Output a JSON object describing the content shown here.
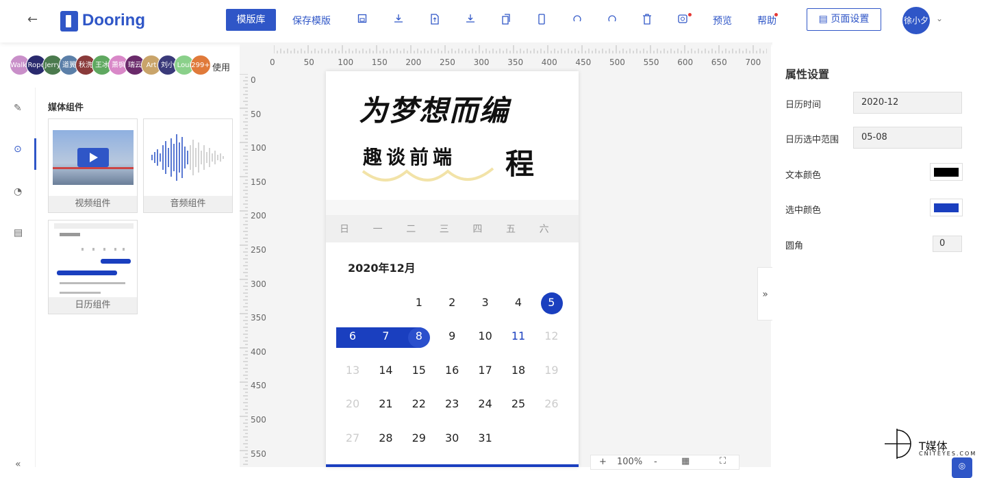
{
  "header": {
    "back_icon": "←",
    "logo": "Dooring",
    "template_btn": "模版库",
    "save_template": "保存模版",
    "preview": "预览",
    "help": "帮助",
    "page_settings": "页面设置",
    "user": "徐小夕",
    "accent": "#2f56c7",
    "toolbar_icons": [
      "save-icon",
      "download-icon",
      "file-upload-icon",
      "export-icon",
      "copy-icon",
      "mobile-icon",
      "undo-icon",
      "redo-icon",
      "trash-icon",
      "screenshot-icon"
    ]
  },
  "collaborators": {
    "names": [
      "Walker",
      "Ropo",
      "Jerry",
      "道翼",
      "秋洗",
      "王冰",
      "萧枫",
      "瑞云",
      "Art",
      "刘小刀",
      "Loui",
      "299+"
    ],
    "use_label": "使用"
  },
  "left_panel": {
    "section_title": "媒体组件",
    "components": [
      {
        "label": "视频组件"
      },
      {
        "label": "音频组件"
      },
      {
        "label": "日历组件"
      }
    ]
  },
  "canvas": {
    "ruler_top": [
      "0",
      "50",
      "100",
      "150",
      "200",
      "250",
      "300",
      "350",
      "400",
      "450",
      "500",
      "550",
      "600",
      "650",
      "700"
    ],
    "ruler_left": [
      "0",
      "50",
      "100",
      "150",
      "200",
      "250",
      "300",
      "350",
      "400",
      "450",
      "500",
      "550"
    ],
    "zoom": "100%",
    "zoom_plus": "+",
    "zoom_minus": "-"
  },
  "calendar": {
    "banner_line1": "为梦想而编",
    "banner_line2": "趣谈前端",
    "banner_line3": "程",
    "weekdays": [
      "日",
      "一",
      "二",
      "三",
      "四",
      "五",
      "六"
    ],
    "month_title": "2020年12月",
    "weeks": [
      [
        "",
        "",
        "1",
        "2",
        "3",
        "4",
        "5"
      ],
      [
        "6",
        "7",
        "8",
        "9",
        "10",
        "11",
        "12"
      ],
      [
        "13",
        "14",
        "15",
        "16",
        "17",
        "18",
        "19"
      ],
      [
        "20",
        "21",
        "22",
        "23",
        "24",
        "25",
        "26"
      ],
      [
        "27",
        "28",
        "29",
        "30",
        "31",
        "",
        ""
      ]
    ],
    "selected_color": "#1a3fbf"
  },
  "props": {
    "title": "属性设置",
    "calendar_time_label": "日历时间",
    "calendar_time": "2020-12",
    "range_label": "日历选中范围",
    "range": "05-08",
    "text_color_label": "文本颜色",
    "text_color": "#000000",
    "selected_color_label": "选中颜色",
    "selected_color": "#1a3fbf",
    "radius_label": "圆角",
    "radius": "0"
  },
  "watermark": {
    "title": "T媒体",
    "sub": "CNITEYES.COM"
  }
}
